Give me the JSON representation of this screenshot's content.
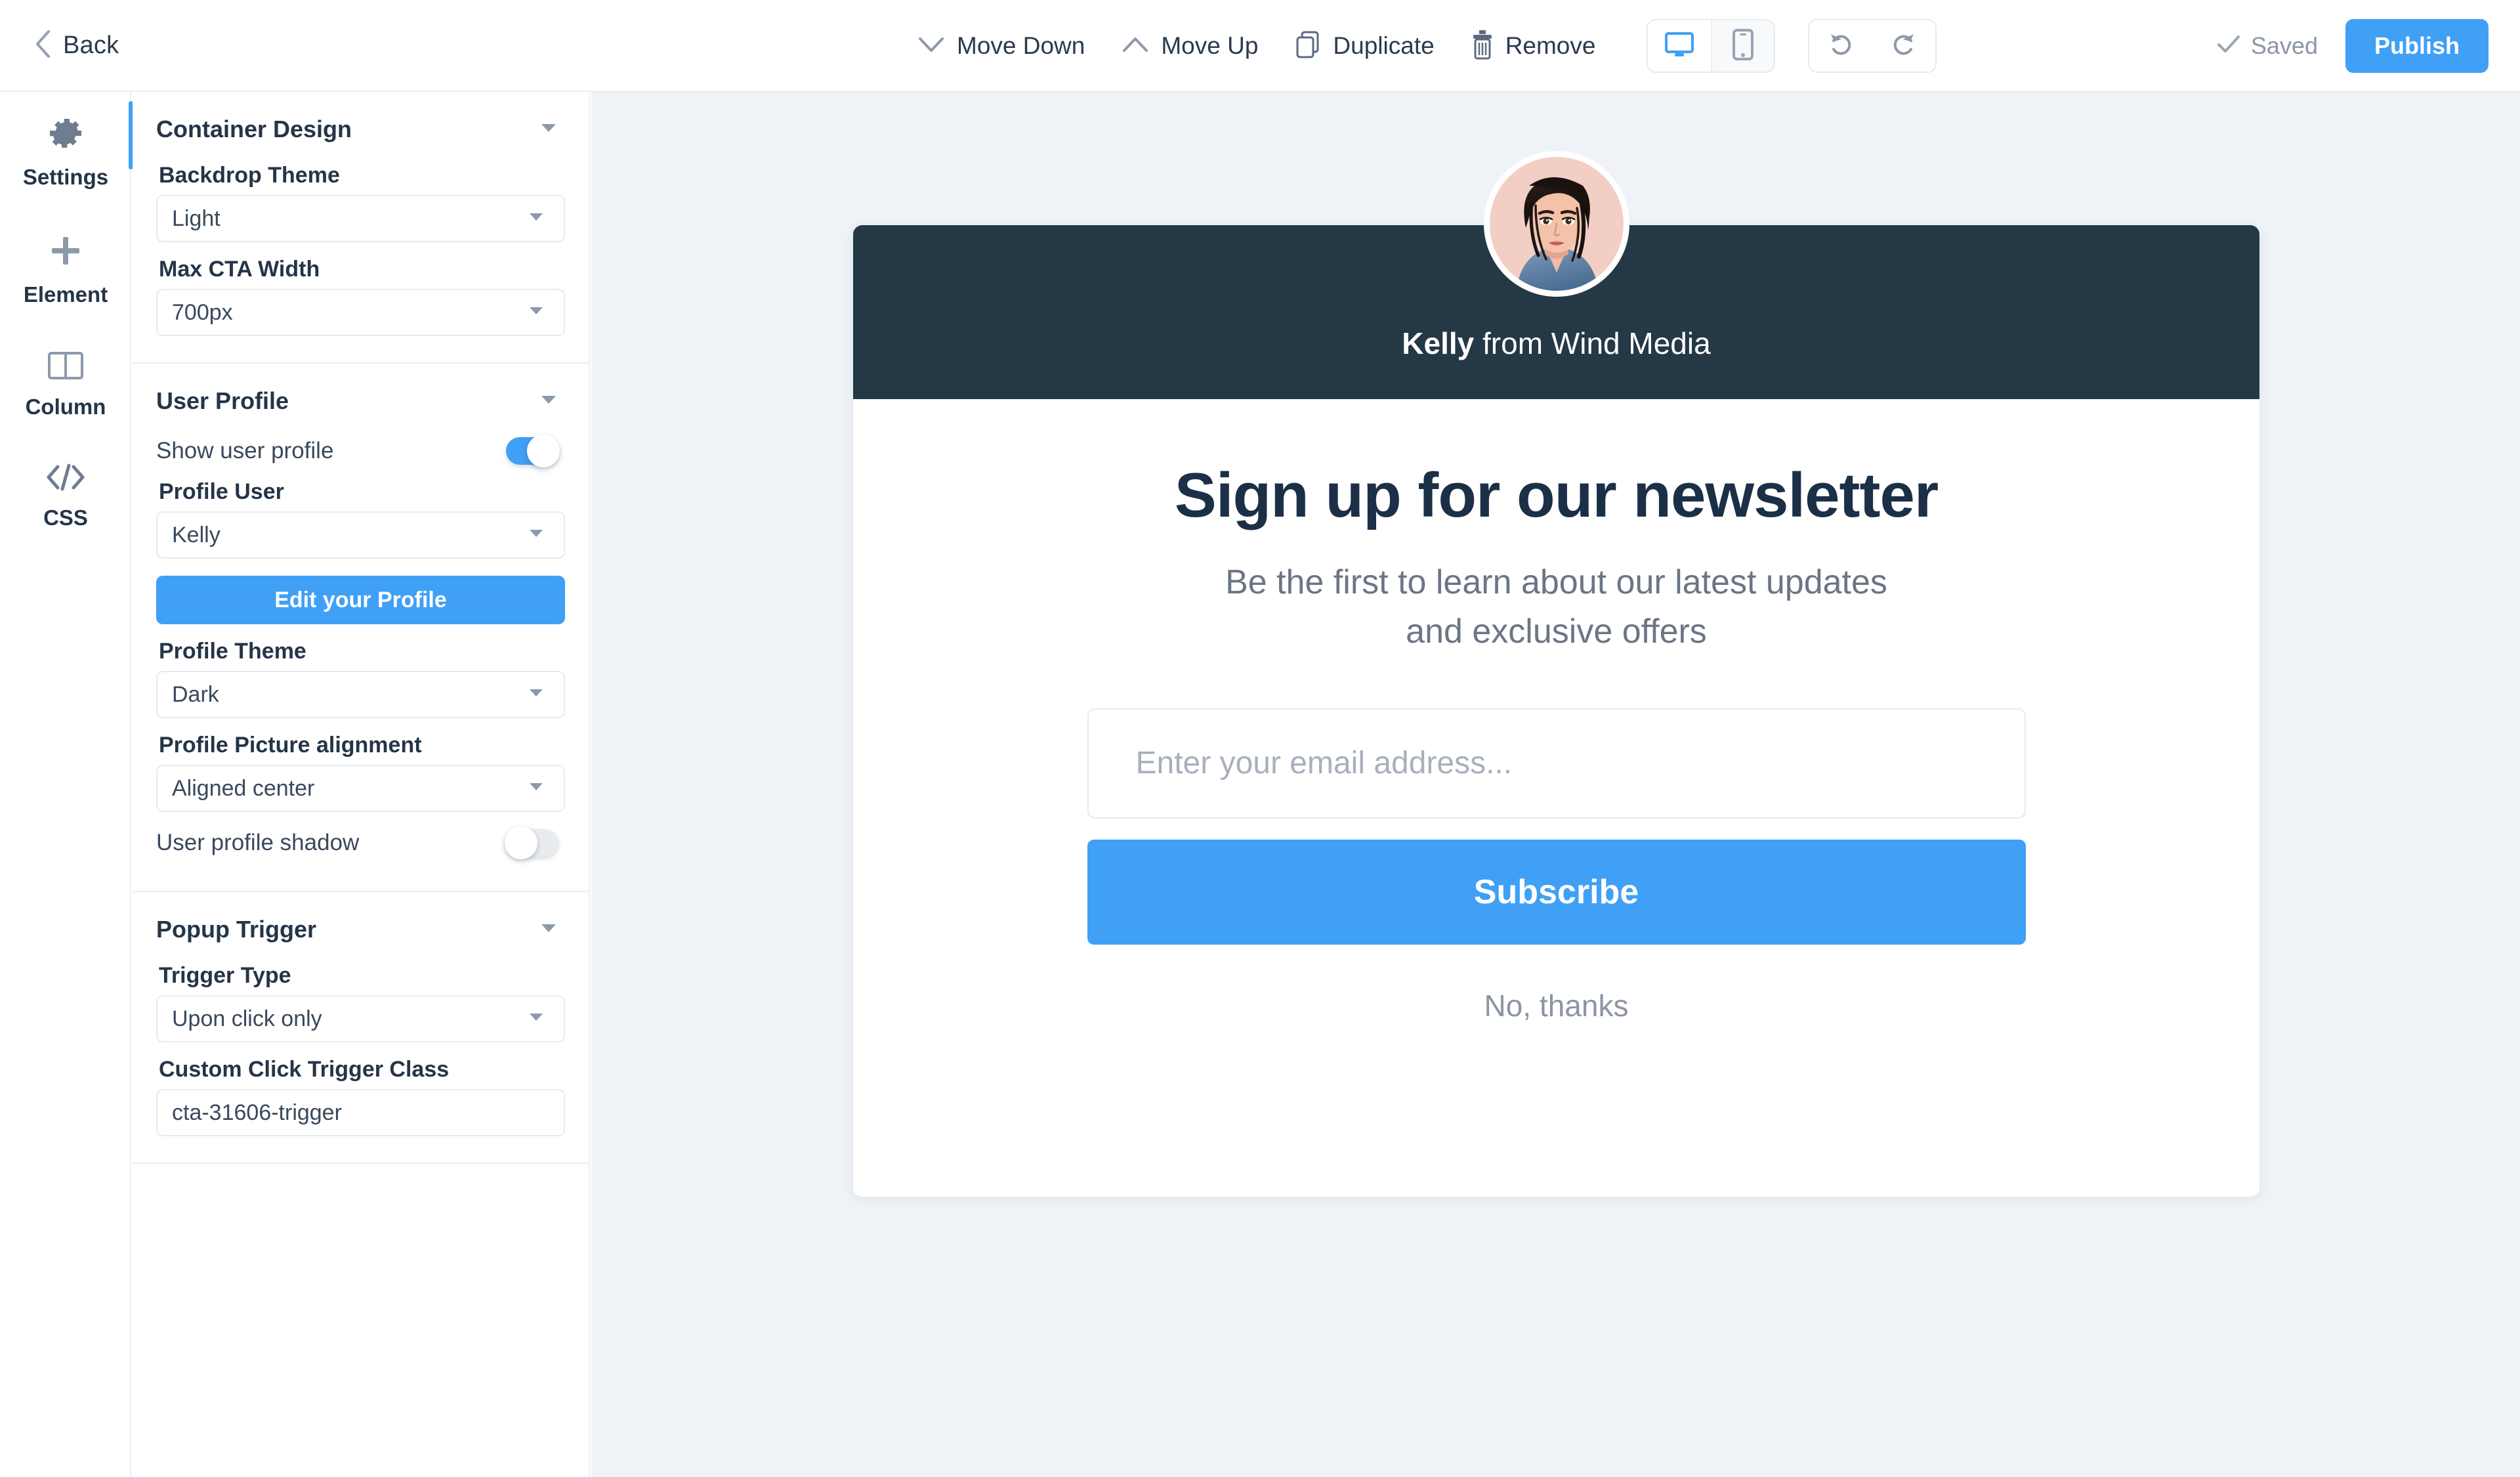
{
  "toolbar": {
    "back_label": "Back",
    "move_down_label": "Move Down",
    "move_up_label": "Move Up",
    "duplicate_label": "Duplicate",
    "remove_label": "Remove",
    "desktop_view_name": "desktop-view",
    "mobile_view_name": "mobile-view",
    "undo_name": "undo",
    "redo_name": "redo",
    "saved_label": "Saved",
    "publish_label": "Publish"
  },
  "rail": {
    "items": [
      {
        "label": "Settings",
        "icon": "gear-icon",
        "active": true
      },
      {
        "label": "Element",
        "icon": "plus-icon",
        "active": false
      },
      {
        "label": "Column",
        "icon": "columns-icon",
        "active": false
      },
      {
        "label": "CSS",
        "icon": "code-icon",
        "active": false
      }
    ]
  },
  "panel": {
    "container_design": {
      "title": "Container Design",
      "backdrop_theme_label": "Backdrop Theme",
      "backdrop_theme_value": "Light",
      "max_cta_width_label": "Max CTA Width",
      "max_cta_width_value": "700px"
    },
    "user_profile": {
      "title": "User Profile",
      "show_user_profile_label": "Show user profile",
      "show_user_profile_on": true,
      "profile_user_label": "Profile User",
      "profile_user_value": "Kelly",
      "edit_profile_label": "Edit your Profile",
      "profile_theme_label": "Profile Theme",
      "profile_theme_value": "Dark",
      "profile_picture_alignment_label": "Profile Picture alignment",
      "profile_picture_alignment_value": "Aligned center",
      "user_profile_shadow_label": "User profile shadow",
      "user_profile_shadow_on": false
    },
    "popup_trigger": {
      "title": "Popup Trigger",
      "trigger_type_label": "Trigger Type",
      "trigger_type_value": "Upon click only",
      "custom_click_trigger_class_label": "Custom Click Trigger Class",
      "custom_click_trigger_class_value": "cta-31606-trigger"
    }
  },
  "cta": {
    "profile_name": "Kelly",
    "profile_suffix": " from Wind Media",
    "headline": "Sign up for our newsletter",
    "subtext": "Be the first to learn about our latest updates and exclusive offers",
    "email_placeholder": "Enter your email address...",
    "email_value": "",
    "subscribe_label": "Subscribe",
    "decline_label": "No, thanks"
  },
  "colors": {
    "accent_blue": "#3fa0f5",
    "profile_dark": "#253845",
    "canvas_bg": "#eff3f7",
    "text_dark": "#253548",
    "text_muted": "#8c96a5"
  }
}
